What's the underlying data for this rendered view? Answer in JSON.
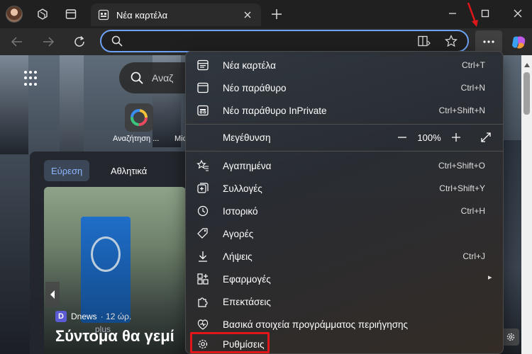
{
  "tab": {
    "title": "Νέα καρτέλα"
  },
  "address": {
    "value": ""
  },
  "page": {
    "search_placeholder": "Αναζ",
    "quick_links": [
      "Αναζήτηση ...",
      "Mic"
    ],
    "feed_tabs": [
      "Εύρεση",
      "Αθλητικά"
    ],
    "source_logo": "D",
    "source_name": "Dnews",
    "source_time": "· 12 ώρ.",
    "headline": "Σύντομα θα γεμί",
    "image_text": "plus"
  },
  "menu": {
    "items": [
      {
        "label": "Νέα καρτέλα",
        "shortcut": "Ctrl+T",
        "icon": "new-tab-icon"
      },
      {
        "label": "Νέο παράθυρο",
        "shortcut": "Ctrl+N",
        "icon": "window-icon"
      },
      {
        "label": "Νέο παράθυρο InPrivate",
        "shortcut": "Ctrl+Shift+N",
        "icon": "inprivate-icon"
      },
      {
        "label": "Μεγέθυνση",
        "shortcut": "",
        "icon": ""
      },
      {
        "label": "Αγαπημένα",
        "shortcut": "Ctrl+Shift+O",
        "icon": "favorites-icon"
      },
      {
        "label": "Συλλογές",
        "shortcut": "Ctrl+Shift+Y",
        "icon": "collections-icon"
      },
      {
        "label": "Ιστορικό",
        "shortcut": "Ctrl+H",
        "icon": "history-icon"
      },
      {
        "label": "Αγορές",
        "shortcut": "",
        "icon": "shopping-icon"
      },
      {
        "label": "Λήψεις",
        "shortcut": "Ctrl+J",
        "icon": "download-icon"
      },
      {
        "label": "Εφαρμογές",
        "shortcut": "",
        "icon": "apps-icon"
      },
      {
        "label": "Επεκτάσεις",
        "shortcut": "",
        "icon": "extensions-icon"
      },
      {
        "label": "Βασικά στοιχεία προγράμματος περιήγησης",
        "shortcut": "",
        "icon": "essentials-icon"
      },
      {
        "label": "Ρυθμίσεις",
        "shortcut": "",
        "icon": "gear-icon"
      }
    ],
    "zoom_value": "100%"
  },
  "colors": {
    "accent": "#6ea2f5",
    "highlight": "#e0161b",
    "menu_bg": "#2f353d"
  }
}
